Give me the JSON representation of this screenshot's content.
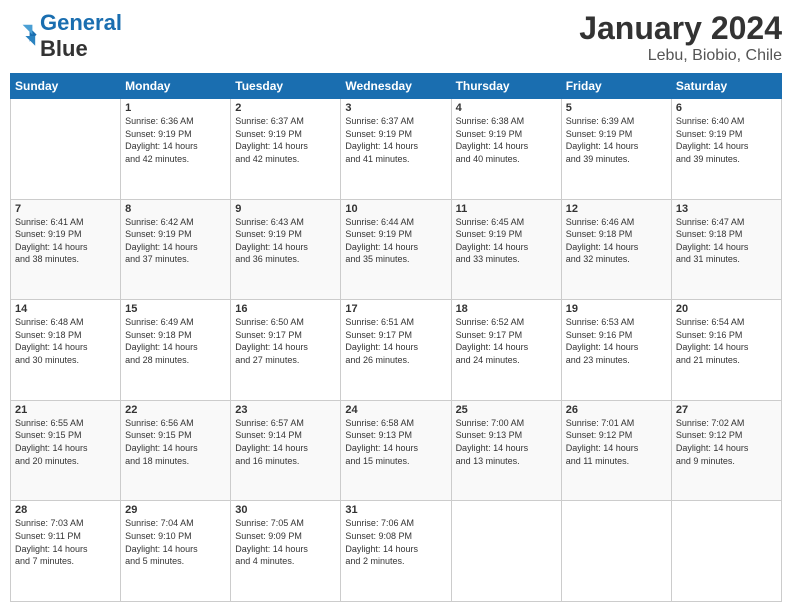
{
  "header": {
    "logo": "GeneralBlue",
    "month": "January 2024",
    "location": "Lebu, Biobio, Chile"
  },
  "weekdays": [
    "Sunday",
    "Monday",
    "Tuesday",
    "Wednesday",
    "Thursday",
    "Friday",
    "Saturday"
  ],
  "weeks": [
    [
      {
        "day": "",
        "info": ""
      },
      {
        "day": "1",
        "info": "Sunrise: 6:36 AM\nSunset: 9:19 PM\nDaylight: 14 hours\nand 42 minutes."
      },
      {
        "day": "2",
        "info": "Sunrise: 6:37 AM\nSunset: 9:19 PM\nDaylight: 14 hours\nand 42 minutes."
      },
      {
        "day": "3",
        "info": "Sunrise: 6:37 AM\nSunset: 9:19 PM\nDaylight: 14 hours\nand 41 minutes."
      },
      {
        "day": "4",
        "info": "Sunrise: 6:38 AM\nSunset: 9:19 PM\nDaylight: 14 hours\nand 40 minutes."
      },
      {
        "day": "5",
        "info": "Sunrise: 6:39 AM\nSunset: 9:19 PM\nDaylight: 14 hours\nand 39 minutes."
      },
      {
        "day": "6",
        "info": "Sunrise: 6:40 AM\nSunset: 9:19 PM\nDaylight: 14 hours\nand 39 minutes."
      }
    ],
    [
      {
        "day": "7",
        "info": "Sunrise: 6:41 AM\nSunset: 9:19 PM\nDaylight: 14 hours\nand 38 minutes."
      },
      {
        "day": "8",
        "info": "Sunrise: 6:42 AM\nSunset: 9:19 PM\nDaylight: 14 hours\nand 37 minutes."
      },
      {
        "day": "9",
        "info": "Sunrise: 6:43 AM\nSunset: 9:19 PM\nDaylight: 14 hours\nand 36 minutes."
      },
      {
        "day": "10",
        "info": "Sunrise: 6:44 AM\nSunset: 9:19 PM\nDaylight: 14 hours\nand 35 minutes."
      },
      {
        "day": "11",
        "info": "Sunrise: 6:45 AM\nSunset: 9:19 PM\nDaylight: 14 hours\nand 33 minutes."
      },
      {
        "day": "12",
        "info": "Sunrise: 6:46 AM\nSunset: 9:18 PM\nDaylight: 14 hours\nand 32 minutes."
      },
      {
        "day": "13",
        "info": "Sunrise: 6:47 AM\nSunset: 9:18 PM\nDaylight: 14 hours\nand 31 minutes."
      }
    ],
    [
      {
        "day": "14",
        "info": "Sunrise: 6:48 AM\nSunset: 9:18 PM\nDaylight: 14 hours\nand 30 minutes."
      },
      {
        "day": "15",
        "info": "Sunrise: 6:49 AM\nSunset: 9:18 PM\nDaylight: 14 hours\nand 28 minutes."
      },
      {
        "day": "16",
        "info": "Sunrise: 6:50 AM\nSunset: 9:17 PM\nDaylight: 14 hours\nand 27 minutes."
      },
      {
        "day": "17",
        "info": "Sunrise: 6:51 AM\nSunset: 9:17 PM\nDaylight: 14 hours\nand 26 minutes."
      },
      {
        "day": "18",
        "info": "Sunrise: 6:52 AM\nSunset: 9:17 PM\nDaylight: 14 hours\nand 24 minutes."
      },
      {
        "day": "19",
        "info": "Sunrise: 6:53 AM\nSunset: 9:16 PM\nDaylight: 14 hours\nand 23 minutes."
      },
      {
        "day": "20",
        "info": "Sunrise: 6:54 AM\nSunset: 9:16 PM\nDaylight: 14 hours\nand 21 minutes."
      }
    ],
    [
      {
        "day": "21",
        "info": "Sunrise: 6:55 AM\nSunset: 9:15 PM\nDaylight: 14 hours\nand 20 minutes."
      },
      {
        "day": "22",
        "info": "Sunrise: 6:56 AM\nSunset: 9:15 PM\nDaylight: 14 hours\nand 18 minutes."
      },
      {
        "day": "23",
        "info": "Sunrise: 6:57 AM\nSunset: 9:14 PM\nDaylight: 14 hours\nand 16 minutes."
      },
      {
        "day": "24",
        "info": "Sunrise: 6:58 AM\nSunset: 9:13 PM\nDaylight: 14 hours\nand 15 minutes."
      },
      {
        "day": "25",
        "info": "Sunrise: 7:00 AM\nSunset: 9:13 PM\nDaylight: 14 hours\nand 13 minutes."
      },
      {
        "day": "26",
        "info": "Sunrise: 7:01 AM\nSunset: 9:12 PM\nDaylight: 14 hours\nand 11 minutes."
      },
      {
        "day": "27",
        "info": "Sunrise: 7:02 AM\nSunset: 9:12 PM\nDaylight: 14 hours\nand 9 minutes."
      }
    ],
    [
      {
        "day": "28",
        "info": "Sunrise: 7:03 AM\nSunset: 9:11 PM\nDaylight: 14 hours\nand 7 minutes."
      },
      {
        "day": "29",
        "info": "Sunrise: 7:04 AM\nSunset: 9:10 PM\nDaylight: 14 hours\nand 5 minutes."
      },
      {
        "day": "30",
        "info": "Sunrise: 7:05 AM\nSunset: 9:09 PM\nDaylight: 14 hours\nand 4 minutes."
      },
      {
        "day": "31",
        "info": "Sunrise: 7:06 AM\nSunset: 9:08 PM\nDaylight: 14 hours\nand 2 minutes."
      },
      {
        "day": "",
        "info": ""
      },
      {
        "day": "",
        "info": ""
      },
      {
        "day": "",
        "info": ""
      }
    ]
  ]
}
